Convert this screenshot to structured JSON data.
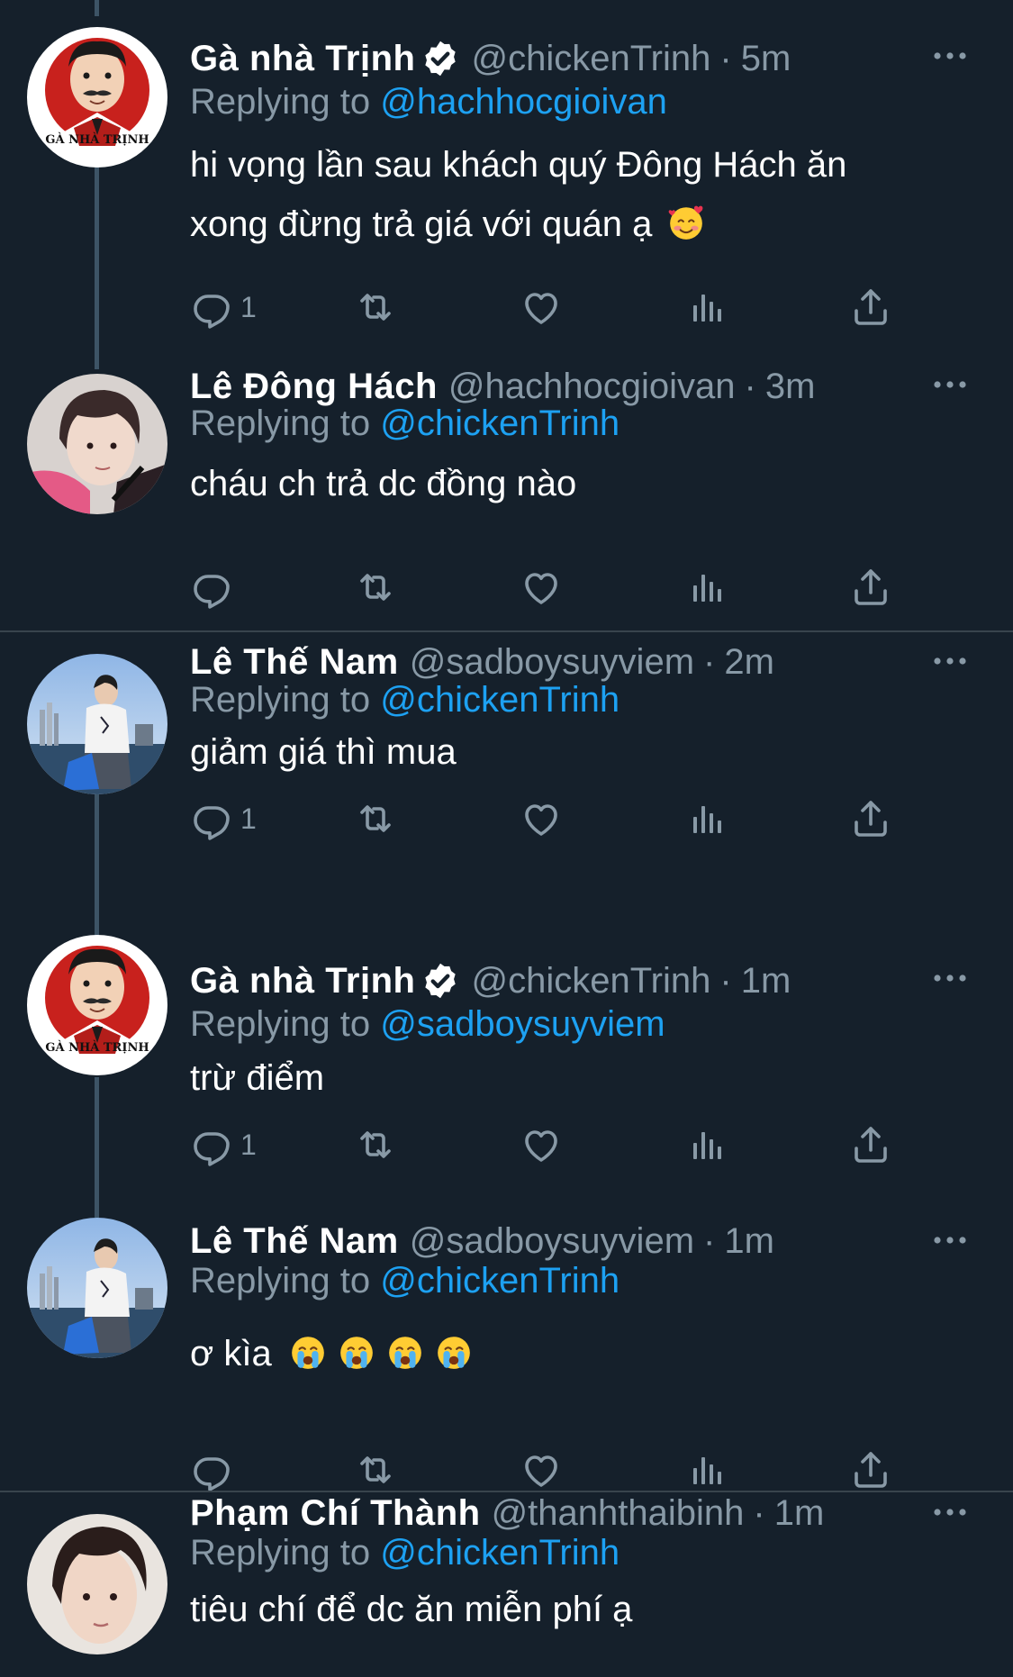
{
  "tweets": [
    {
      "name": "Gà nhà Trịnh",
      "handle": "@chickenTrinh",
      "dot": "·",
      "time": "5m",
      "replying_prefix": "Replying to ",
      "replying_to": "@hachhocgioivan",
      "text_line1": "hi vọng lần sau khách quý Đông Hách ăn",
      "text_line2": "xong đừng trả giá với quán ạ",
      "reply_count": "1"
    },
    {
      "name": "Lê Đông Hách",
      "handle": "@hachhocgioivan",
      "dot": "·",
      "time": "3m",
      "replying_prefix": "Replying to ",
      "replying_to": "@chickenTrinh",
      "text": "cháu ch trả dc đồng nào",
      "reply_count": ""
    },
    {
      "name": "Lê Thế Nam",
      "handle": "@sadboysuyviem",
      "dot": "·",
      "time": "2m",
      "replying_prefix": "Replying to ",
      "replying_to": "@chickenTrinh",
      "text": "giảm giá thì mua",
      "reply_count": "1"
    },
    {
      "name": "Gà nhà Trịnh",
      "handle": "@chickenTrinh",
      "dot": "·",
      "time": "1m",
      "replying_prefix": "Replying to ",
      "replying_to": "@sadboysuyviem",
      "text": "trừ điểm",
      "reply_count": "1"
    },
    {
      "name": "Lê Thế Nam",
      "handle": "@sadboysuyviem",
      "dot": "·",
      "time": "1m",
      "replying_prefix": "Replying to ",
      "replying_to": "@chickenTrinh",
      "text": "ơ kìa",
      "reply_count": ""
    },
    {
      "name": "Phạm Chí Thành",
      "handle": "@thanhthaibinh",
      "dot": "·",
      "time": "1m",
      "replying_prefix": "Replying to ",
      "replying_to": "@chickenTrinh",
      "text": "tiêu chí để dc ăn miễn phí ạ",
      "reply_count": ""
    }
  ],
  "avatar_logo_text": "GÀ NHÀ TRỊNH",
  "colors": {
    "background": "#15202b",
    "secondary_text": "#8899a6",
    "mention": "#1da1f2",
    "divider": "#38444d",
    "thread_line": "#3d5466"
  },
  "icons": [
    "reply-icon",
    "retweet-icon",
    "like-icon",
    "analytics-icon",
    "share-icon",
    "more-icon",
    "verified-icon"
  ]
}
